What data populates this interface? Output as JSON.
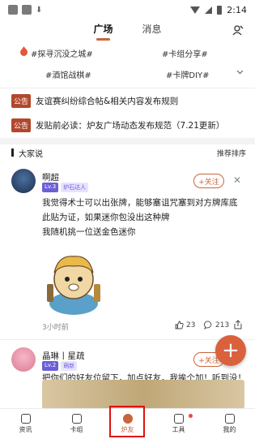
{
  "status": {
    "time": "2:14"
  },
  "nav": {
    "tabs": [
      {
        "label": "广场"
      },
      {
        "label": "消息"
      }
    ]
  },
  "topics": [
    {
      "label": "#探寻沉没之城#"
    },
    {
      "label": "#卡组分享#"
    },
    {
      "label": "#酒馆战棋#"
    },
    {
      "label": "#卡牌DIY#"
    }
  ],
  "notices": [
    {
      "badge": "公告",
      "text": "友谊赛纠纷综合帖&相关内容发布规则"
    },
    {
      "badge": "公告",
      "text": "发贴前必读：炉友广场动态发布规范（7.21更新）"
    }
  ],
  "section": {
    "title": "大家说",
    "sort_label": "推荐排序"
  },
  "posts": [
    {
      "username": "啊超",
      "level": "Lv.3",
      "tag": "炉石达人",
      "follow_label": "+关注",
      "lines": [
        "我觉得术士可以出张牌，能够塞诅咒塞到对方牌库底",
        "此贴为证，如果迷你包没出这种牌",
        "我随机挑一位送金色迷你"
      ],
      "time_ago": "3小时前",
      "likes": "23",
      "comments": "213"
    },
    {
      "username": "晶琳丨星疏",
      "level": "Lv.2",
      "tag": "萌新",
      "follow_label": "+关注",
      "lines": [
        "把你们的好友位留下，加点好友，我挨个加！听到没！"
      ]
    }
  ],
  "fab_label": "+",
  "bottom_nav": [
    {
      "label": "资讯"
    },
    {
      "label": "卡组"
    },
    {
      "label": "炉友"
    },
    {
      "label": "工具"
    },
    {
      "label": "我的"
    }
  ],
  "colors": {
    "accent": "#c9653b",
    "badge": "#b2472c",
    "fab": "#d9623d",
    "highlight": "#e01010"
  }
}
